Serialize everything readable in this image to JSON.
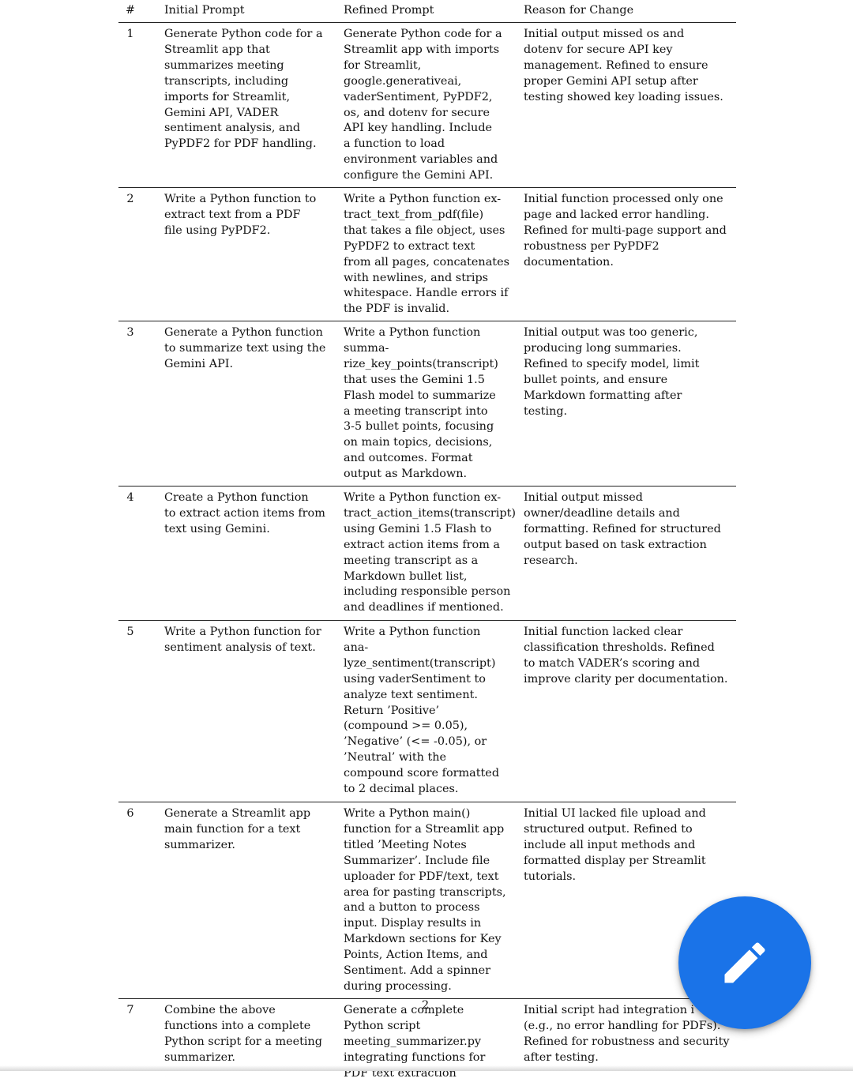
{
  "table": {
    "headers": [
      "#",
      "Initial Prompt",
      "Refined Prompt",
      "Reason for Change"
    ],
    "rows": [
      {
        "num": "1",
        "initial": "Generate Python code for a\nStreamlit app that\nsummarizes meeting\ntranscripts, including\nimports for Streamlit,\nGemini API, VADER\nsentiment analysis, and\nPyPDF2 for PDF handling.",
        "refined": "Generate Python code for a\nStreamlit app with imports\nfor Streamlit,\ngoogle.generativeai,\nvaderSentiment, PyPDF2,\nos, and dotenv for secure\nAPI key handling. Include\na function to load\nenvironment variables and\nconfigure the Gemini API.",
        "reason": "Initial output missed os and\ndotenv for secure API key\nmanagement. Refined to ensure\nproper Gemini API setup after\ntesting showed key loading issues."
      },
      {
        "num": "2",
        "initial": "Write a Python function to\nextract text from a PDF\nfile using PyPDF2.",
        "refined": "Write a Python function ex-\ntract_text_from_pdf(file)\nthat takes a file object, uses\nPyPDF2 to extract text\nfrom all pages, concatenates\nwith newlines, and strips\nwhitespace. Handle errors if\nthe PDF is invalid.",
        "reason": "Initial function processed only one\npage and lacked error handling.\nRefined for multi-page support and\nrobustness per PyPDF2\ndocumentation."
      },
      {
        "num": "3",
        "initial": "Generate a Python function\nto summarize text using the\nGemini API.",
        "refined": "Write a Python function\nsumma-\nrize_key_points(transcript)\nthat uses the Gemini 1.5\nFlash model to summarize\na meeting transcript into\n3-5 bullet points, focusing\non main topics, decisions,\nand outcomes. Format\noutput as Markdown.",
        "reason": "Initial output was too generic,\nproducing long summaries.\nRefined to specify model, limit\nbullet points, and ensure\nMarkdown formatting after\ntesting."
      },
      {
        "num": "4",
        "initial": "Create a Python function\nto extract action items from\ntext using Gemini.",
        "refined": "Write a Python function ex-\ntract_action_items(transcript)\nusing Gemini 1.5 Flash to\nextract action items from a\nmeeting transcript as a\nMarkdown bullet list,\nincluding responsible person\nand deadlines if mentioned.",
        "reason": "Initial output missed\nowner/deadline details and\nformatting. Refined for structured\noutput based on task extraction\nresearch."
      },
      {
        "num": "5",
        "initial": "Write a Python function for\nsentiment analysis of text.",
        "refined": "Write a Python function\nana-\nlyze_sentiment(transcript)\nusing vaderSentiment to\nanalyze text sentiment.\nReturn ’Positive’\n(compound >= 0.05),\n’Negative’ (<= -0.05), or\n’Neutral’ with the\ncompound score formatted\nto 2 decimal places.",
        "reason": "Initial function lacked clear\nclassification thresholds. Refined\nto match VADER’s scoring and\nimprove clarity per documentation."
      },
      {
        "num": "6",
        "initial": "Generate a Streamlit app\nmain function for a text\nsummarizer.",
        "refined": "Write a Python main()\nfunction for a Streamlit app\ntitled ’Meeting Notes\nSummarizer’. Include file\nuploader for PDF/text, text\narea for pasting transcripts,\nand a button to process\ninput. Display results in\nMarkdown sections for Key\nPoints, Action Items, and\nSentiment. Add a spinner\nduring processing.",
        "reason": "Initial UI lacked file upload and\nstructured output. Refined to\ninclude all input methods and\nformatted display per Streamlit\ntutorials."
      },
      {
        "num": "7",
        "initial": "Combine the above\nfunctions into a complete\nPython script for a meeting\nsummarizer.",
        "refined": "Generate a complete\nPython script\nmeeting_summarizer.py\nintegrating functions for\nPDF text extraction",
        "reason": "Initial script had integration i\n(e.g., no error handling for PDFs).\nRefined for robustness and security\nafter testing."
      }
    ]
  },
  "page_number": "2",
  "fab": {
    "icon": "pencil-icon",
    "color": "#1a73e8"
  }
}
